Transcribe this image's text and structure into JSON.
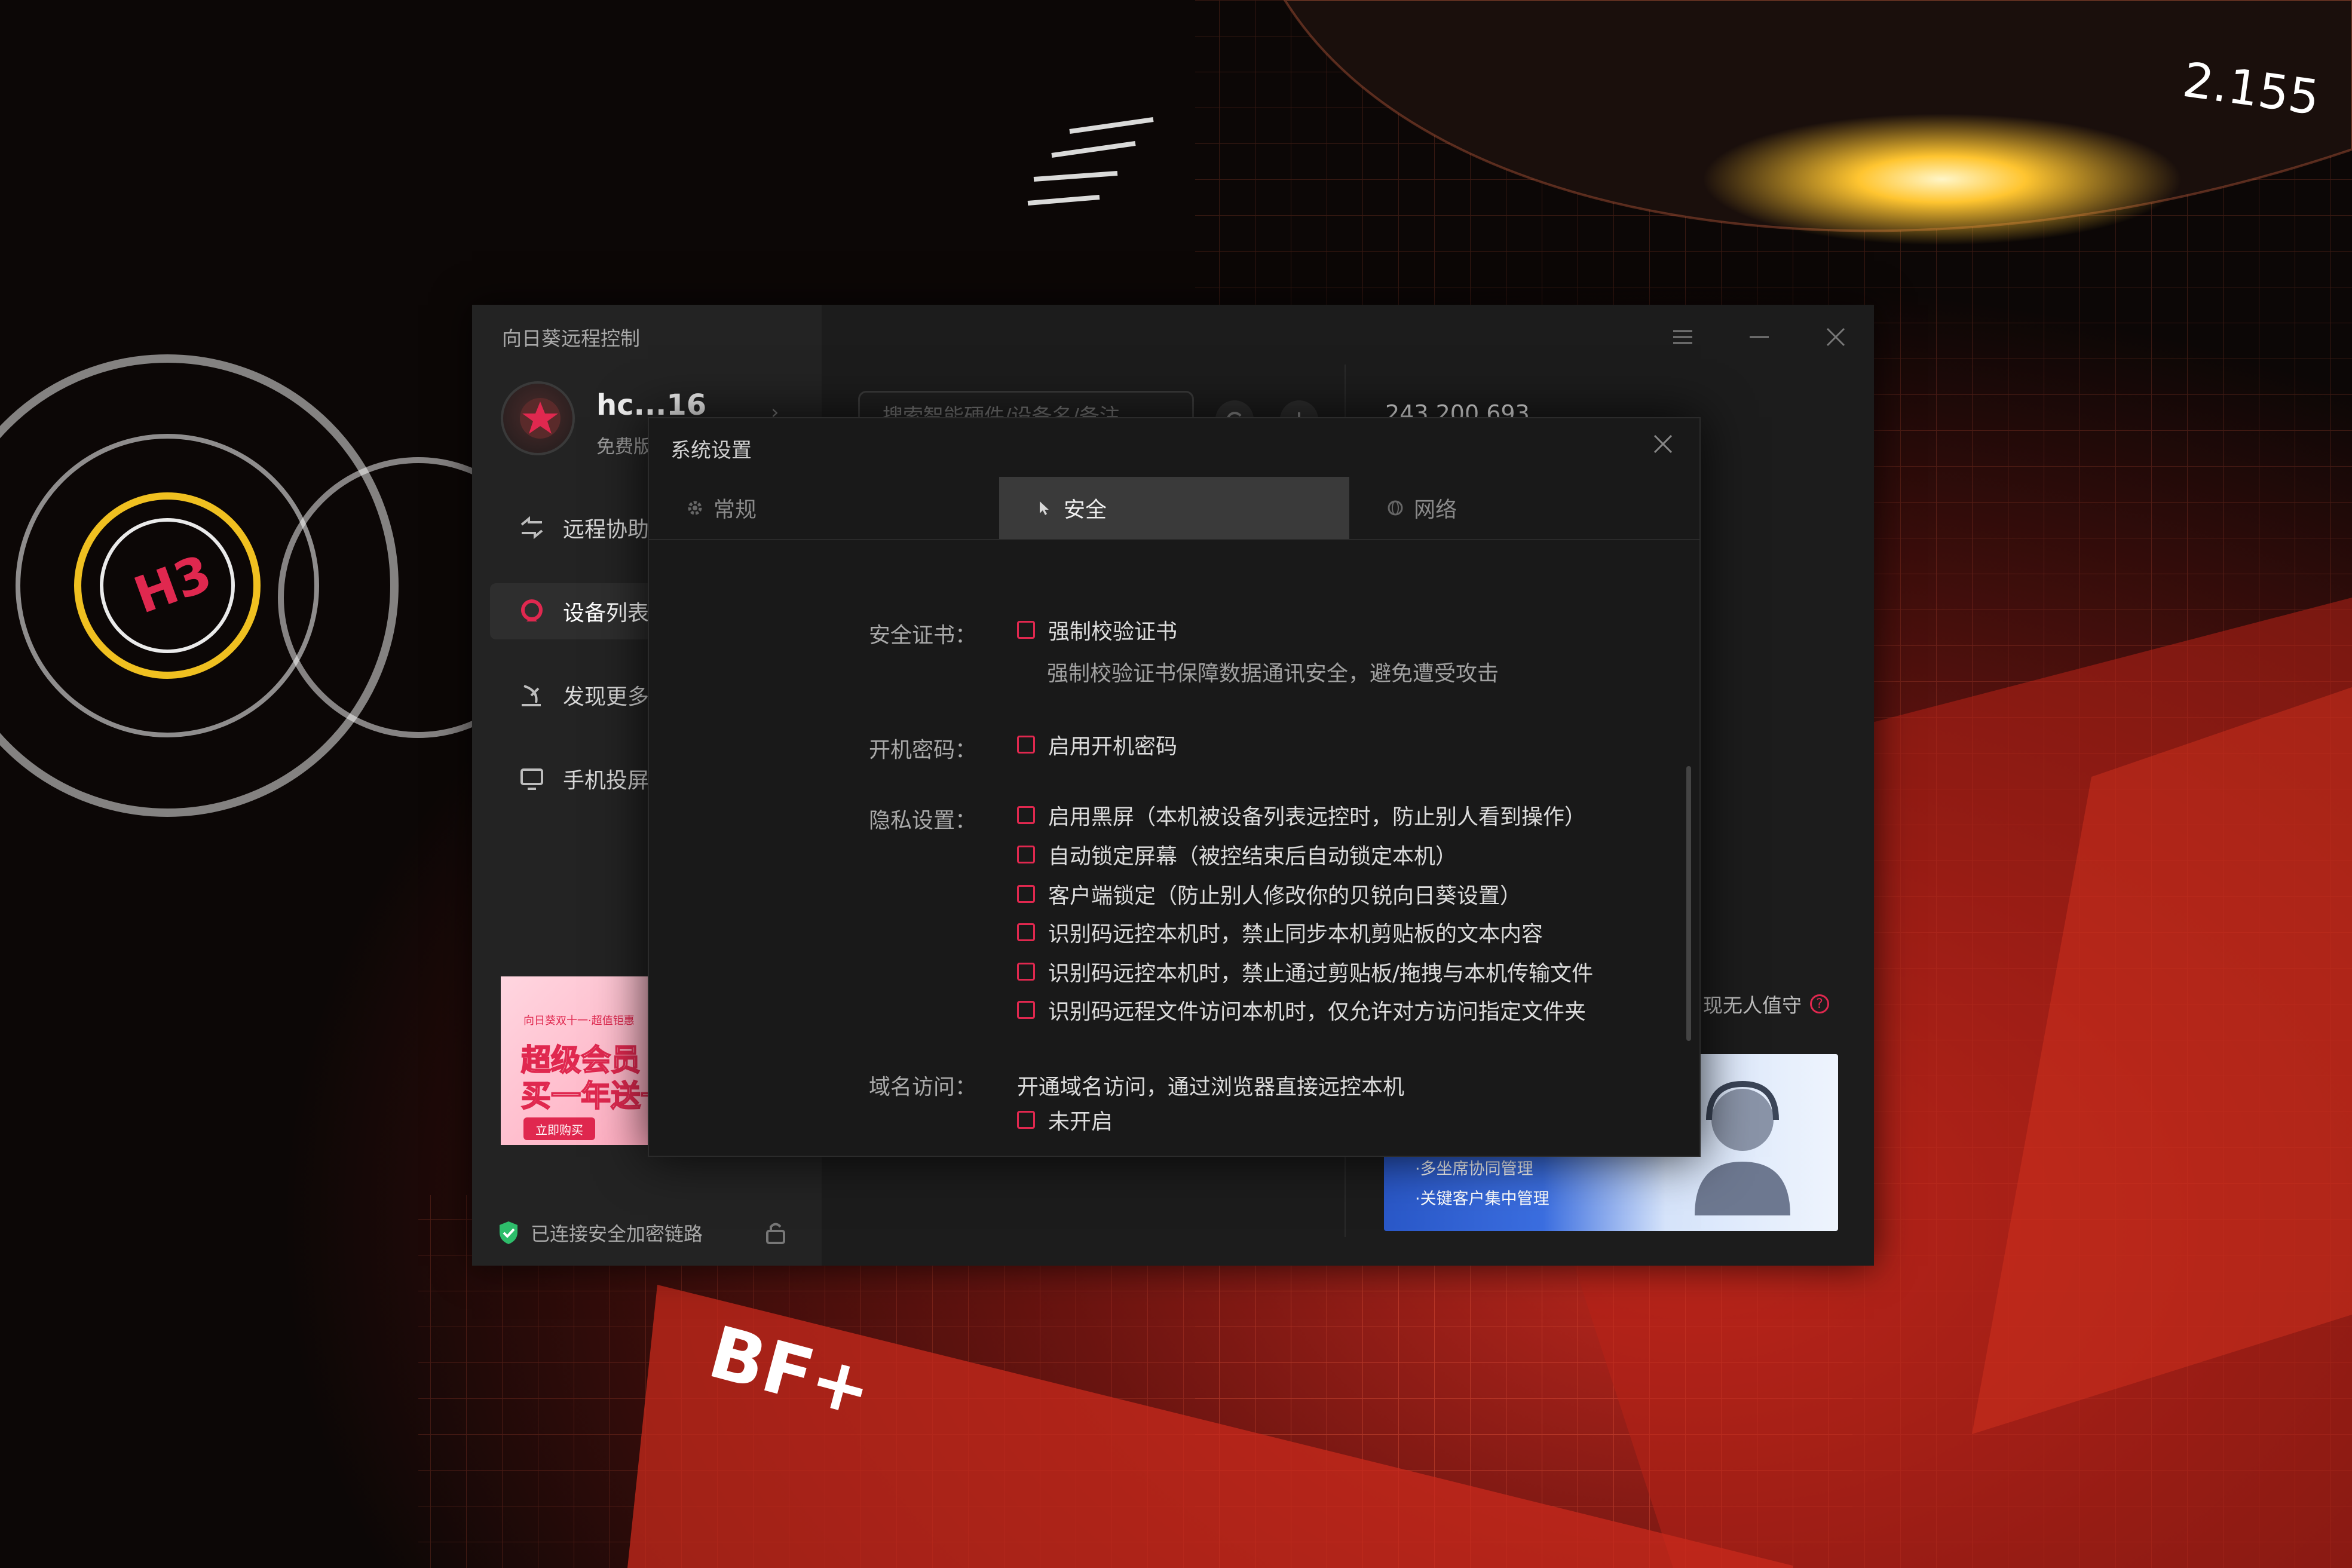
{
  "app": {
    "title": "向日葵远程控制",
    "profile": {
      "name": "hc...16",
      "subtitle": "免费版"
    },
    "nav": [
      {
        "label": "远程协助",
        "icon": "remote-assist-icon",
        "active": false
      },
      {
        "label": "设备列表",
        "icon": "device-list-icon",
        "active": true
      },
      {
        "label": "发现更多",
        "icon": "discover-icon",
        "active": false
      },
      {
        "label": "手机投屏",
        "icon": "screen-cast-icon",
        "active": false
      }
    ],
    "promo": {
      "top": "向日葵双十一·超值钜惠",
      "line1": "超级会员",
      "line2": "买一年送一",
      "button": "立即购买"
    },
    "secure_status": "已连接安全加密链路",
    "search_placeholder": "搜索智能硬件/设备名/备注",
    "device_id": "243 200 693",
    "unattended_text": "现无人值守",
    "ad_lines": [
      "·多坐席协同管理",
      "·关键客户集中管理"
    ],
    "accent_color": "#e0284f"
  },
  "dialog": {
    "title": "系统设置",
    "tabs": [
      {
        "label": "常规",
        "icon": "gear-icon",
        "active": false
      },
      {
        "label": "安全",
        "icon": "cursor-icon",
        "active": true
      },
      {
        "label": "网络",
        "icon": "globe-icon",
        "active": false
      }
    ],
    "security_cert": {
      "label": "安全证书：",
      "option": "强制校验证书",
      "hint": "强制校验证书保障数据通讯安全，避免遭受攻击"
    },
    "boot_password": {
      "label": "开机密码：",
      "option": "启用开机密码"
    },
    "privacy": {
      "label": "隐私设置：",
      "options": [
        "启用黑屏（本机被设备列表远控时，防止别人看到操作）",
        "自动锁定屏幕（被控结束后自动锁定本机）",
        "客户端锁定（防止别人修改你的贝锐向日葵设置）",
        "识别码远控本机时，禁止同步本机剪贴板的文本内容",
        "识别码远控本机时，禁止通过剪贴板/拖拽与本机传输文件",
        "识别码远程文件访问本机时，仅允许对方访问指定文件夹"
      ]
    },
    "domain_access": {
      "label": "域名访问：",
      "description": "开通域名访问，通过浏览器直接远控本机",
      "option": "未开启"
    }
  },
  "wallpaper": {
    "hud_number": "2.155",
    "badge_left": "H3",
    "badge_bottom": "BF+"
  }
}
